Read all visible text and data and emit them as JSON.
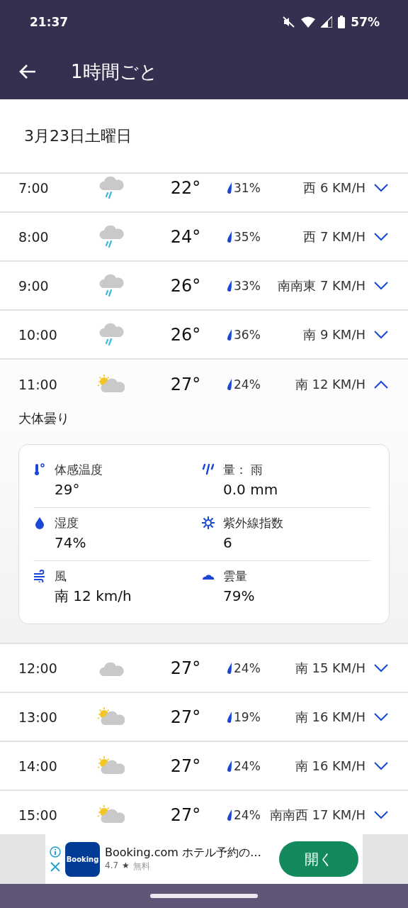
{
  "status_bar": {
    "time": "21:37",
    "battery": "57%"
  },
  "app_bar": {
    "title": "1時間ごと"
  },
  "date_header": "3月23日土曜日",
  "hours": [
    {
      "time": "7:00",
      "kind": "rain",
      "temp": "22°",
      "precip": "31%",
      "wind": "西 6 KM/H",
      "expanded": false
    },
    {
      "time": "8:00",
      "kind": "rain",
      "temp": "24°",
      "precip": "35%",
      "wind": "西 7 KM/H",
      "expanded": false
    },
    {
      "time": "9:00",
      "kind": "rain",
      "temp": "26°",
      "precip": "33%",
      "wind": "南南東 7 KM/H",
      "expanded": false
    },
    {
      "time": "10:00",
      "kind": "rain",
      "temp": "26°",
      "precip": "36%",
      "wind": "南 9 KM/H",
      "expanded": false
    },
    {
      "time": "11:00",
      "kind": "partly_cloudy",
      "temp": "27°",
      "precip": "24%",
      "wind": "南 12 KM/H",
      "expanded": true,
      "summary": "大体曇り",
      "details": [
        {
          "kind": "feels_like",
          "label": "体感温度",
          "value": "29°"
        },
        {
          "kind": "rain_amount",
          "label": "量： 雨",
          "value": "0.0 mm"
        },
        {
          "kind": "humidity",
          "label": "湿度",
          "value": "74%"
        },
        {
          "kind": "uv",
          "label": "紫外線指数",
          "value": "6"
        },
        {
          "kind": "wind",
          "label": "風",
          "value": "南 12 km/h"
        },
        {
          "kind": "cloud_cover",
          "label": "雲量",
          "value": "79%"
        }
      ]
    },
    {
      "time": "12:00",
      "kind": "cloudy",
      "temp": "27°",
      "precip": "24%",
      "wind": "南 15 KM/H",
      "expanded": false
    },
    {
      "time": "13:00",
      "kind": "partly_cloudy",
      "temp": "27°",
      "precip": "19%",
      "wind": "南 16 KM/H",
      "expanded": false
    },
    {
      "time": "14:00",
      "kind": "partly_cloudy",
      "temp": "27°",
      "precip": "24%",
      "wind": "南 16 KM/H",
      "expanded": false
    },
    {
      "time": "15:00",
      "kind": "partly_cloudy",
      "temp": "27°",
      "precip": "24%",
      "wind": "南南西 17 KM/H",
      "expanded": false
    }
  ],
  "ad": {
    "logo": "Booking",
    "title": "Booking.com ホテル予約の…",
    "rating": "4.7",
    "star": "★",
    "price": "無料",
    "button": "開く"
  }
}
